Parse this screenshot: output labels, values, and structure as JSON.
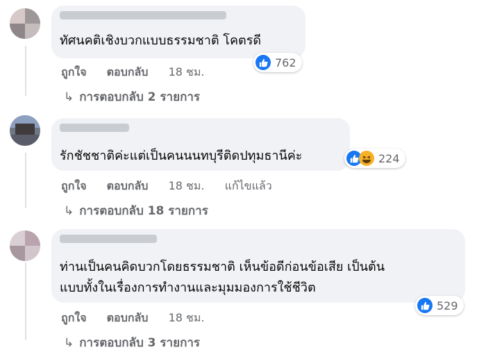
{
  "colors": {
    "like_blue": "#1877f2",
    "haha_yellow": "#f7b125",
    "meta_gray": "#65676b",
    "bubble_bg": "#f0f2f5"
  },
  "icons": {
    "like": "like-reaction-icon",
    "haha": "haha-reaction-icon",
    "reply_arrow": "reply-arrow-icon"
  },
  "comments": [
    {
      "text_lines": [
        "ทัศนคติเชิงบวกแบบธรรมชาติ โคตรดี"
      ],
      "like_label": "ถูกใจ",
      "reply_label": "ตอบกลับ",
      "time": "18 ชม.",
      "edited": "",
      "reaction_count": "762",
      "replies_link": "การตอบกลับ 2 รายการ"
    },
    {
      "text_lines": [
        "รักชัชชาติค่ะแต่เป็นคนนนทบุรีติดปทุมธานีค่ะ"
      ],
      "like_label": "ถูกใจ",
      "reply_label": "ตอบกลับ",
      "time": "18 ชม.",
      "edited": "แก้ไขแล้ว",
      "reaction_count": "224",
      "replies_link": "การตอบกลับ 18 รายการ"
    },
    {
      "text_lines": [
        "ท่านเป็นคนคิดบวกโดยธรรมชาติ เห็นข้อดีก่อนข้อเสีย เป็นต้น",
        "แบบทั้งในเรื่องการทำงานและมุมมองการใช้ชีวิต"
      ],
      "like_label": "ถูกใจ",
      "reply_label": "ตอบกลับ",
      "time": "18 ชม.",
      "edited": "",
      "reaction_count": "529",
      "replies_link": "การตอบกลับ 3 รายการ"
    }
  ]
}
